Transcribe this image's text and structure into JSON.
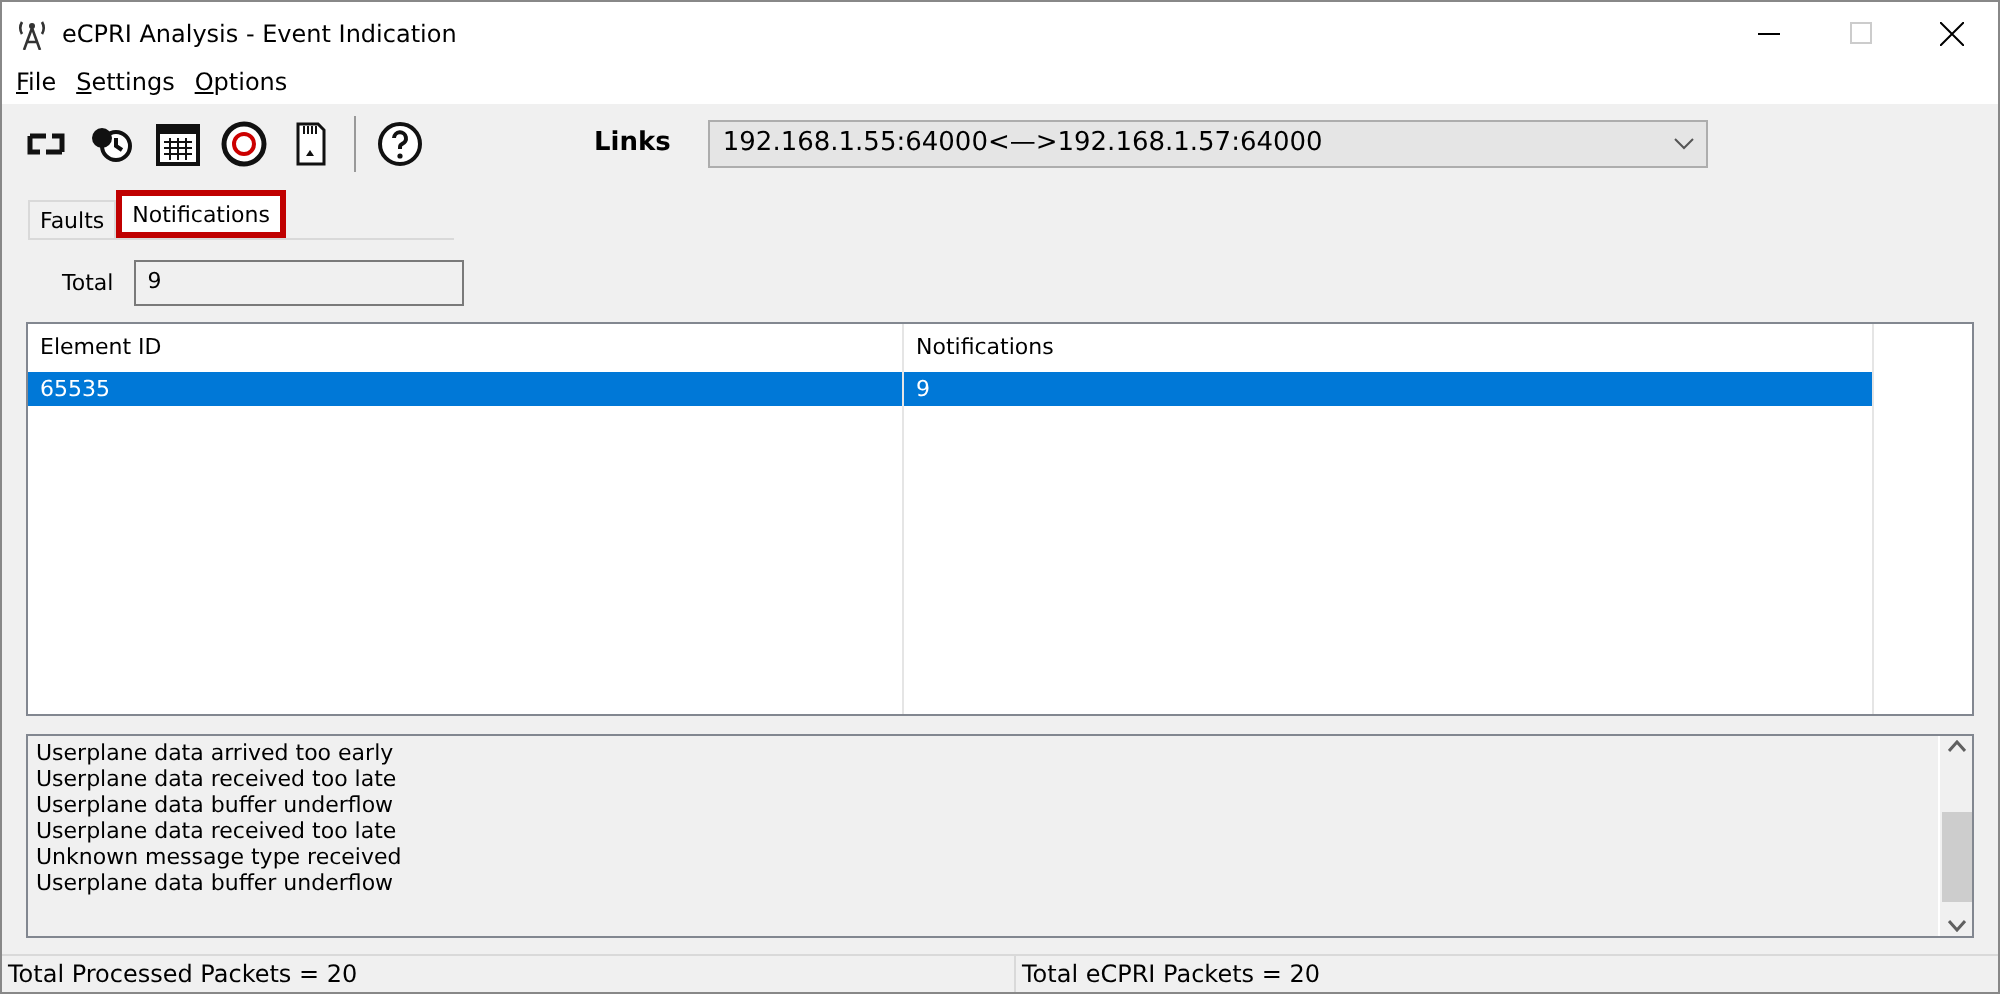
{
  "window": {
    "title": "eCPRI Analysis - Event Indication",
    "maximize_disabled": true
  },
  "menu": [
    {
      "label": "File"
    },
    {
      "label": "Settings"
    },
    {
      "label": "Options"
    }
  ],
  "toolbar": {
    "links_label": "Links",
    "links_value": "192.168.1.55:64000<—>192.168.1.57:64000"
  },
  "tabs": [
    {
      "label": "Faults",
      "selected": false,
      "highlighted": false
    },
    {
      "label": "Notifications",
      "selected": true,
      "highlighted": true
    }
  ],
  "total": {
    "label": "Total",
    "value": "9"
  },
  "table": {
    "columns": [
      "Element ID",
      "Notifications"
    ],
    "rows": [
      {
        "cells": [
          "65535",
          "9"
        ],
        "selected": true
      }
    ]
  },
  "log": [
    "Userplane data arrived too early",
    "Userplane data received too late",
    "Userplane data buffer underflow",
    "Userplane data received too late",
    "Unknown message type received",
    "Userplane data buffer underflow"
  ],
  "status_bar": [
    "Total Processed Packets = 20",
    "Total eCPRI Packets = 20"
  ]
}
